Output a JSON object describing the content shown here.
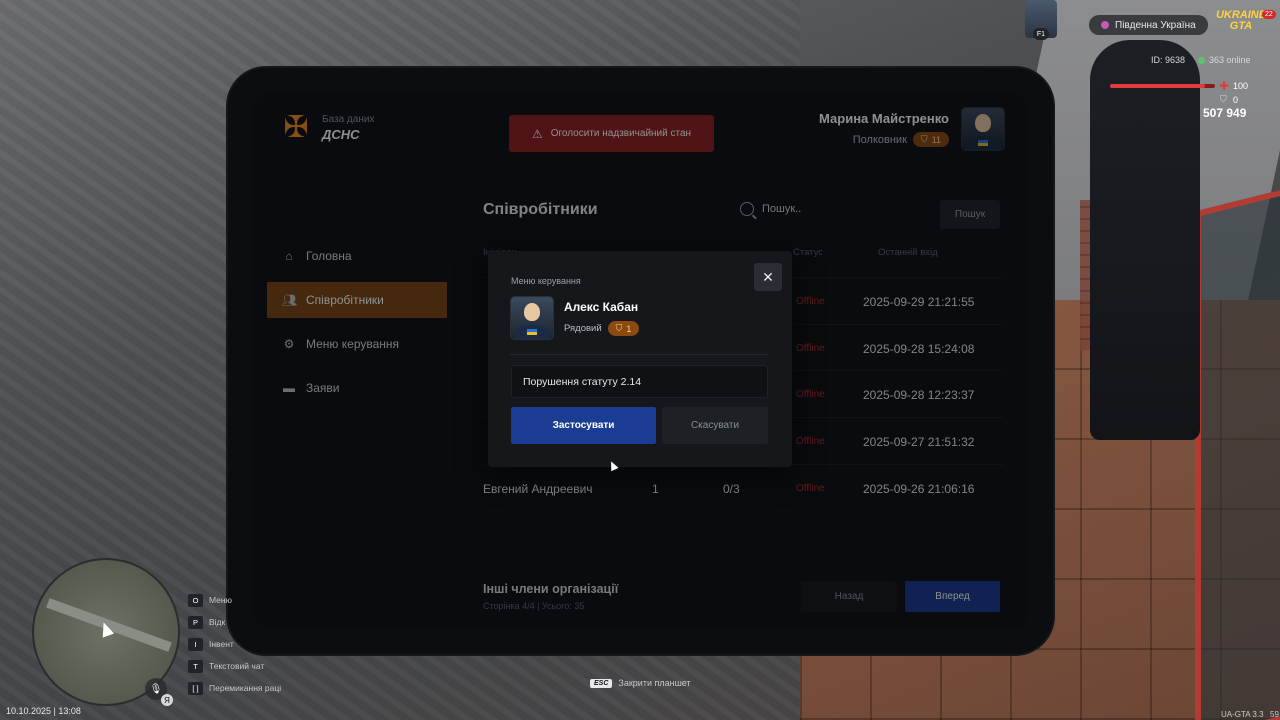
{
  "app": {
    "db_subtitle": "База даних",
    "db_title": "ДСНС",
    "emergency_label": "Оголосити надзвичайний стан",
    "user": {
      "name": "Марина Майстренко",
      "rank": "Полковник",
      "level": "11"
    }
  },
  "nav": [
    {
      "label": "Головна",
      "icon": "home-icon"
    },
    {
      "label": "Співробітники",
      "icon": "users-icon",
      "active": true
    },
    {
      "label": "Меню керування",
      "icon": "gear-icon"
    },
    {
      "label": "Заяви",
      "icon": "folder-icon"
    }
  ],
  "page": {
    "title": "Співробітники",
    "search_placeholder": "Пошук..",
    "search_button": "Пошук"
  },
  "table": {
    "headers": {
      "name": "Ініціали",
      "status": "Статус",
      "last_login": "Останній вхід"
    },
    "rows": [
      {
        "name": "",
        "col2": "",
        "col3": "",
        "status": "Offline",
        "last_login": "2025-09-29 21:21:55"
      },
      {
        "name": "",
        "col2": "",
        "col3": "",
        "status": "Offline",
        "last_login": "2025-09-28 15:24:08"
      },
      {
        "name": "",
        "col2": "",
        "col3": "",
        "status": "Offline",
        "last_login": "2025-09-28 12:23:37"
      },
      {
        "name": "",
        "col2": "",
        "col3": "",
        "status": "Offline",
        "last_login": "2025-09-27 21:51:32"
      },
      {
        "name": "Евгений Андреевич",
        "col2": "1",
        "col3": "0/3",
        "status": "Offline",
        "last_login": "2025-09-26 21:06:16"
      }
    ]
  },
  "footer": {
    "title": "Інші члени організації",
    "page_info": "Сторінка 4/4 | Усього: 35",
    "back": "Назад",
    "next": "Вперед"
  },
  "modal": {
    "label": "Меню керування",
    "close": "✕",
    "name": "Алекс Кабан",
    "rank": "Рядовий",
    "level": "1",
    "input_value": "Порушення статуту 2.14",
    "apply": "Застосувати",
    "cancel": "Скасувати"
  },
  "hud": {
    "server": "Південна Україна",
    "game_logo": "UKRAINE GTA",
    "logo_badge": "22",
    "f1": "F1",
    "id": "ID: 9638",
    "online": "363 online",
    "hp": "100",
    "hp_fraction": 0.9,
    "armor": "0",
    "money": "507 949",
    "keys": [
      {
        "key": "O",
        "label": "Меню"
      },
      {
        "key": "P",
        "label": "Відк"
      },
      {
        "key": "I",
        "label": "Інвент"
      },
      {
        "key": "T",
        "label": "Текстовий чат"
      },
      {
        "key": "[ ]",
        "label": "Перемикання раці"
      }
    ],
    "datetime": "10.10.2025 | 13:08",
    "esc_key": "ESC",
    "esc_label": "Закрити планшет",
    "version": "UA-GTA 3.3",
    "fps": "59",
    "mic_key": "Я"
  }
}
